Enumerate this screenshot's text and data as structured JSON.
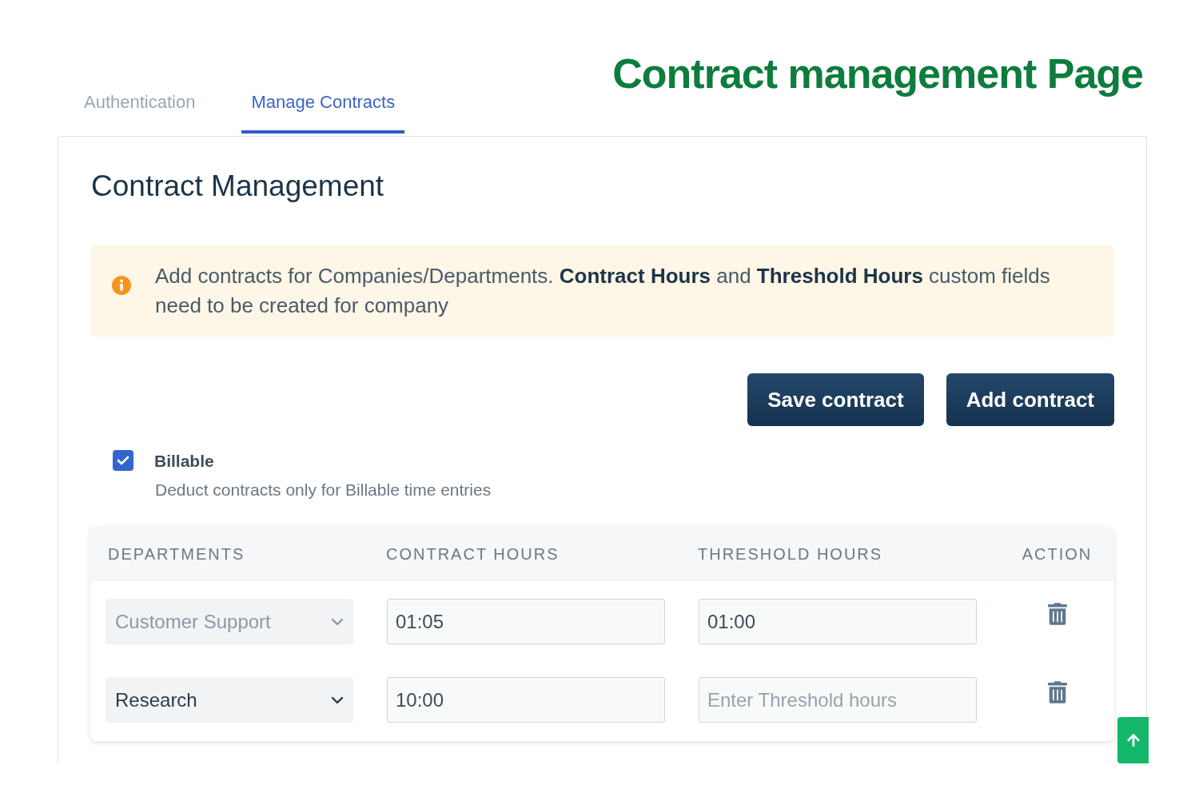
{
  "page_title": "Contract management Page",
  "tabs": [
    {
      "label": "Authentication",
      "selected": false
    },
    {
      "label": "Manage Contracts",
      "selected": true
    }
  ],
  "card": {
    "heading": "Contract Management",
    "alert": {
      "text": "Add contracts for Companies/Departments. **Contract Hours** and **Threshold Hours** custom fields need to be created for company"
    },
    "buttons": [
      "Save contract",
      "Add contract"
    ],
    "billable": {
      "label": "Billable",
      "checked": true,
      "description": "Deduct contracts only for Billable time entries"
    },
    "table": {
      "columns": [
        "DEPARTMENTS",
        "CONTRACT HOURS",
        "THRESHOLD HOURS",
        "ACTION"
      ],
      "rows": [
        {
          "department": {
            "value": "Customer Support",
            "disabled": true
          },
          "contract_hours": {
            "value": "01:05"
          },
          "threshold_hours": {
            "value": "01:00"
          }
        },
        {
          "department": {
            "value": "Research",
            "disabled": false
          },
          "contract_hours": {
            "value": "10:00"
          },
          "threshold_hours": {
            "placeholder": "Enter Threshold hours"
          }
        }
      ]
    }
  }
}
